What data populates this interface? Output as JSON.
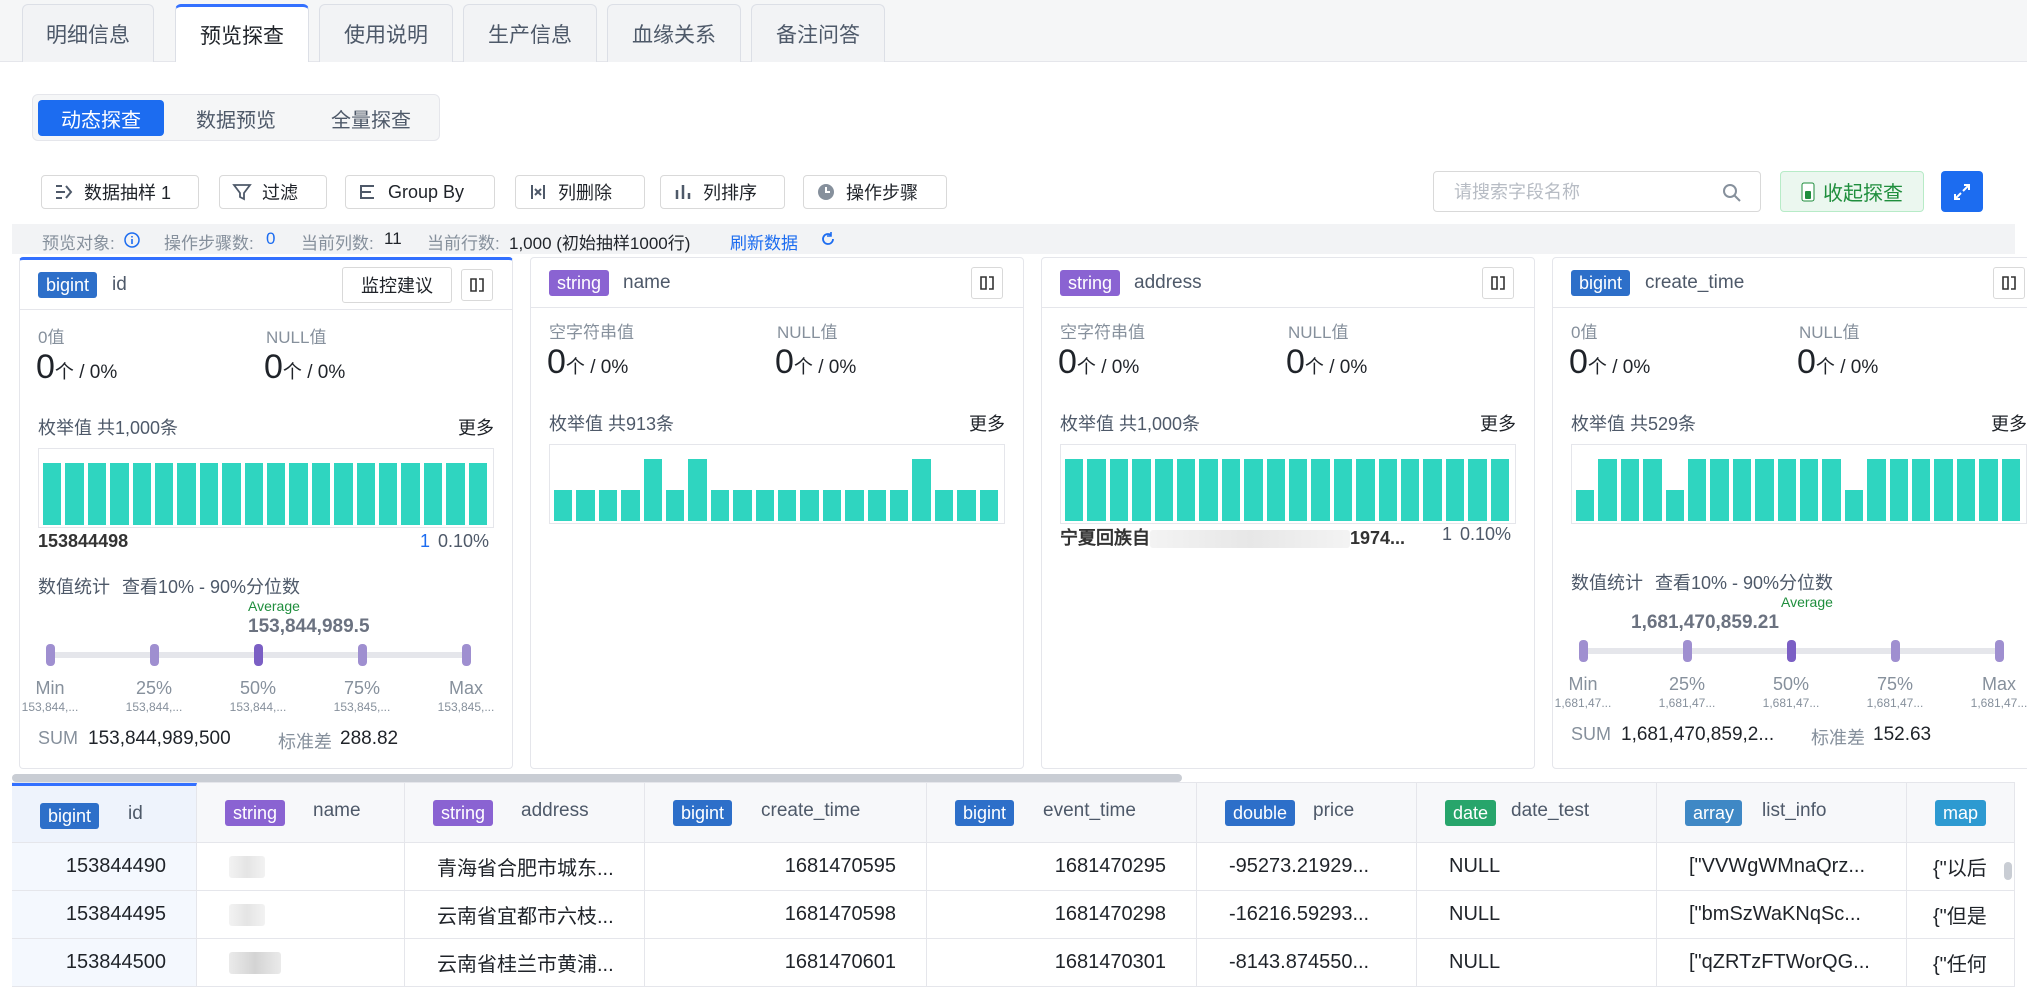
{
  "tabs": [
    "明细信息",
    "预览探查",
    "使用说明",
    "生产信息",
    "血缘关系",
    "备注问答"
  ],
  "subtabs": [
    "动态探查",
    "数据预览",
    "全量探查"
  ],
  "toolbar": {
    "sample": "数据抽样 1",
    "filter": "过滤",
    "groupby": "Group By",
    "delete_col": "列删除",
    "sort_col": "列排序",
    "steps": "操作步骤",
    "search_placeholder": "请搜索字段名称",
    "collapse": "收起探查"
  },
  "info": {
    "target_label": "预览对象:",
    "steps_label": "操作步骤数:",
    "steps_value": "0",
    "cols_label": "当前列数:",
    "cols_value": "11",
    "rows_label": "当前行数:",
    "rows_value": "1,000 (初始抽样1000行)",
    "refresh": "刷新数据"
  },
  "cards": {
    "id": {
      "type": "bigint",
      "name": "id",
      "monitor": "监控建议",
      "stat1_label": "0值",
      "stat1_value": "0",
      "stat2_label": "NULL值",
      "stat2_value": "0",
      "unit": "个 / 0%",
      "enum": "枚举值 共1,000条",
      "more": "更多",
      "top_value": "153844498",
      "top_count": "1",
      "top_pct": "0.10%",
      "numstat": "数值统计",
      "pct_link": "查看10% - 90%分位数",
      "avg_label": "Average",
      "avg_value": "153,844,989.5",
      "q_labels": [
        "Min",
        "25%",
        "50%",
        "75%",
        "Max"
      ],
      "q_values": [
        "153,844,...",
        "153,844,...",
        "153,844,...",
        "153,845,...",
        "153,845,..."
      ],
      "sum_label": "SUM",
      "sum_value": "153,844,989,500",
      "std_label": "标准差",
      "std_value": "288.82",
      "bars": [
        1,
        1,
        1,
        1,
        1,
        1,
        1,
        1,
        1,
        1,
        1,
        1,
        1,
        1,
        1,
        1,
        1,
        1,
        1,
        1
      ]
    },
    "name": {
      "type": "string",
      "name": "name",
      "stat1_label": "空字符串值",
      "stat1_value": "0",
      "stat2_label": "NULL值",
      "stat2_value": "0",
      "unit": "个 / 0%",
      "enum": "枚举值 共913条",
      "more": "更多",
      "bars": [
        0.5,
        0.5,
        0.5,
        0.5,
        1,
        0.5,
        1,
        0.5,
        0.5,
        0.5,
        0.5,
        0.5,
        0.5,
        0.5,
        0.5,
        0.5,
        1,
        0.5,
        0.5,
        0.5
      ]
    },
    "address": {
      "type": "string",
      "name": "address",
      "stat1_label": "空字符串值",
      "stat1_value": "0",
      "stat2_label": "NULL值",
      "stat2_value": "0",
      "unit": "个 / 0%",
      "enum": "枚举值 共1,000条",
      "more": "更多",
      "top_value_a": "宁夏回族自",
      "top_value_b": "1974...",
      "top_count": "1",
      "top_pct": "0.10%",
      "bars": [
        1,
        1,
        1,
        1,
        1,
        1,
        1,
        1,
        1,
        1,
        1,
        1,
        1,
        1,
        1,
        1,
        1,
        1,
        1,
        1
      ]
    },
    "create_time": {
      "type": "bigint",
      "name": "create_time",
      "stat1_label": "0值",
      "stat1_value": "0",
      "stat2_label": "NULL值",
      "stat2_value": "0",
      "unit": "个 / 0%",
      "enum": "枚举值 共529条",
      "more": "更多",
      "numstat": "数值统计",
      "pct_link": "查看10% - 90%分位数",
      "avg_label": "Average",
      "avg_value": "1,681,470,859.21",
      "q_labels": [
        "Min",
        "25%",
        "50%",
        "75%",
        "Max"
      ],
      "q_values": [
        "1,681,47...",
        "1,681,47...",
        "1,681,47...",
        "1,681,47...",
        "1,681,47..."
      ],
      "sum_label": "SUM",
      "sum_value": "1,681,470,859,2...",
      "std_label": "标准差",
      "std_value": "152.63",
      "bars": [
        0.5,
        1,
        1,
        1,
        0.5,
        1,
        1,
        1,
        1,
        1,
        1,
        1,
        0.5,
        1,
        1,
        1,
        1,
        1,
        1,
        1
      ]
    }
  },
  "table": {
    "columns": [
      {
        "type": "bigint",
        "name": "id"
      },
      {
        "type": "string",
        "name": "name"
      },
      {
        "type": "string",
        "name": "address"
      },
      {
        "type": "bigint",
        "name": "create_time"
      },
      {
        "type": "bigint",
        "name": "event_time"
      },
      {
        "type": "double",
        "name": "price"
      },
      {
        "type": "date",
        "name": "date_test"
      },
      {
        "type": "array",
        "name": "list_info"
      },
      {
        "type": "map",
        "name": ""
      }
    ],
    "rows": [
      {
        "id": "153844490",
        "address": "青海省合肥市城东...",
        "create_time": "1681470595",
        "event_time": "1681470295",
        "price": "-95273.21929...",
        "date_test": "NULL",
        "list_info": "[\"VVWgWMnaQrz...",
        "map": "{\"以后"
      },
      {
        "id": "153844495",
        "address": "云南省宜都市六枝...",
        "create_time": "1681470598",
        "event_time": "1681470298",
        "price": "-16216.59293...",
        "date_test": "NULL",
        "list_info": "[\"bmSzWaKNqSc...",
        "map": "{\"但是"
      },
      {
        "id": "153844500",
        "address": "云南省桂兰市黄浦...",
        "create_time": "1681470601",
        "event_time": "1681470301",
        "price": "-8143.874550...",
        "date_test": "NULL",
        "list_info": "[\"qZRTzFTWorQG...",
        "map": "{\"任何"
      }
    ]
  },
  "colors": {
    "accent": "#1c6cf0",
    "bar": "#2fd5c0",
    "success": "#1f8e3d"
  }
}
